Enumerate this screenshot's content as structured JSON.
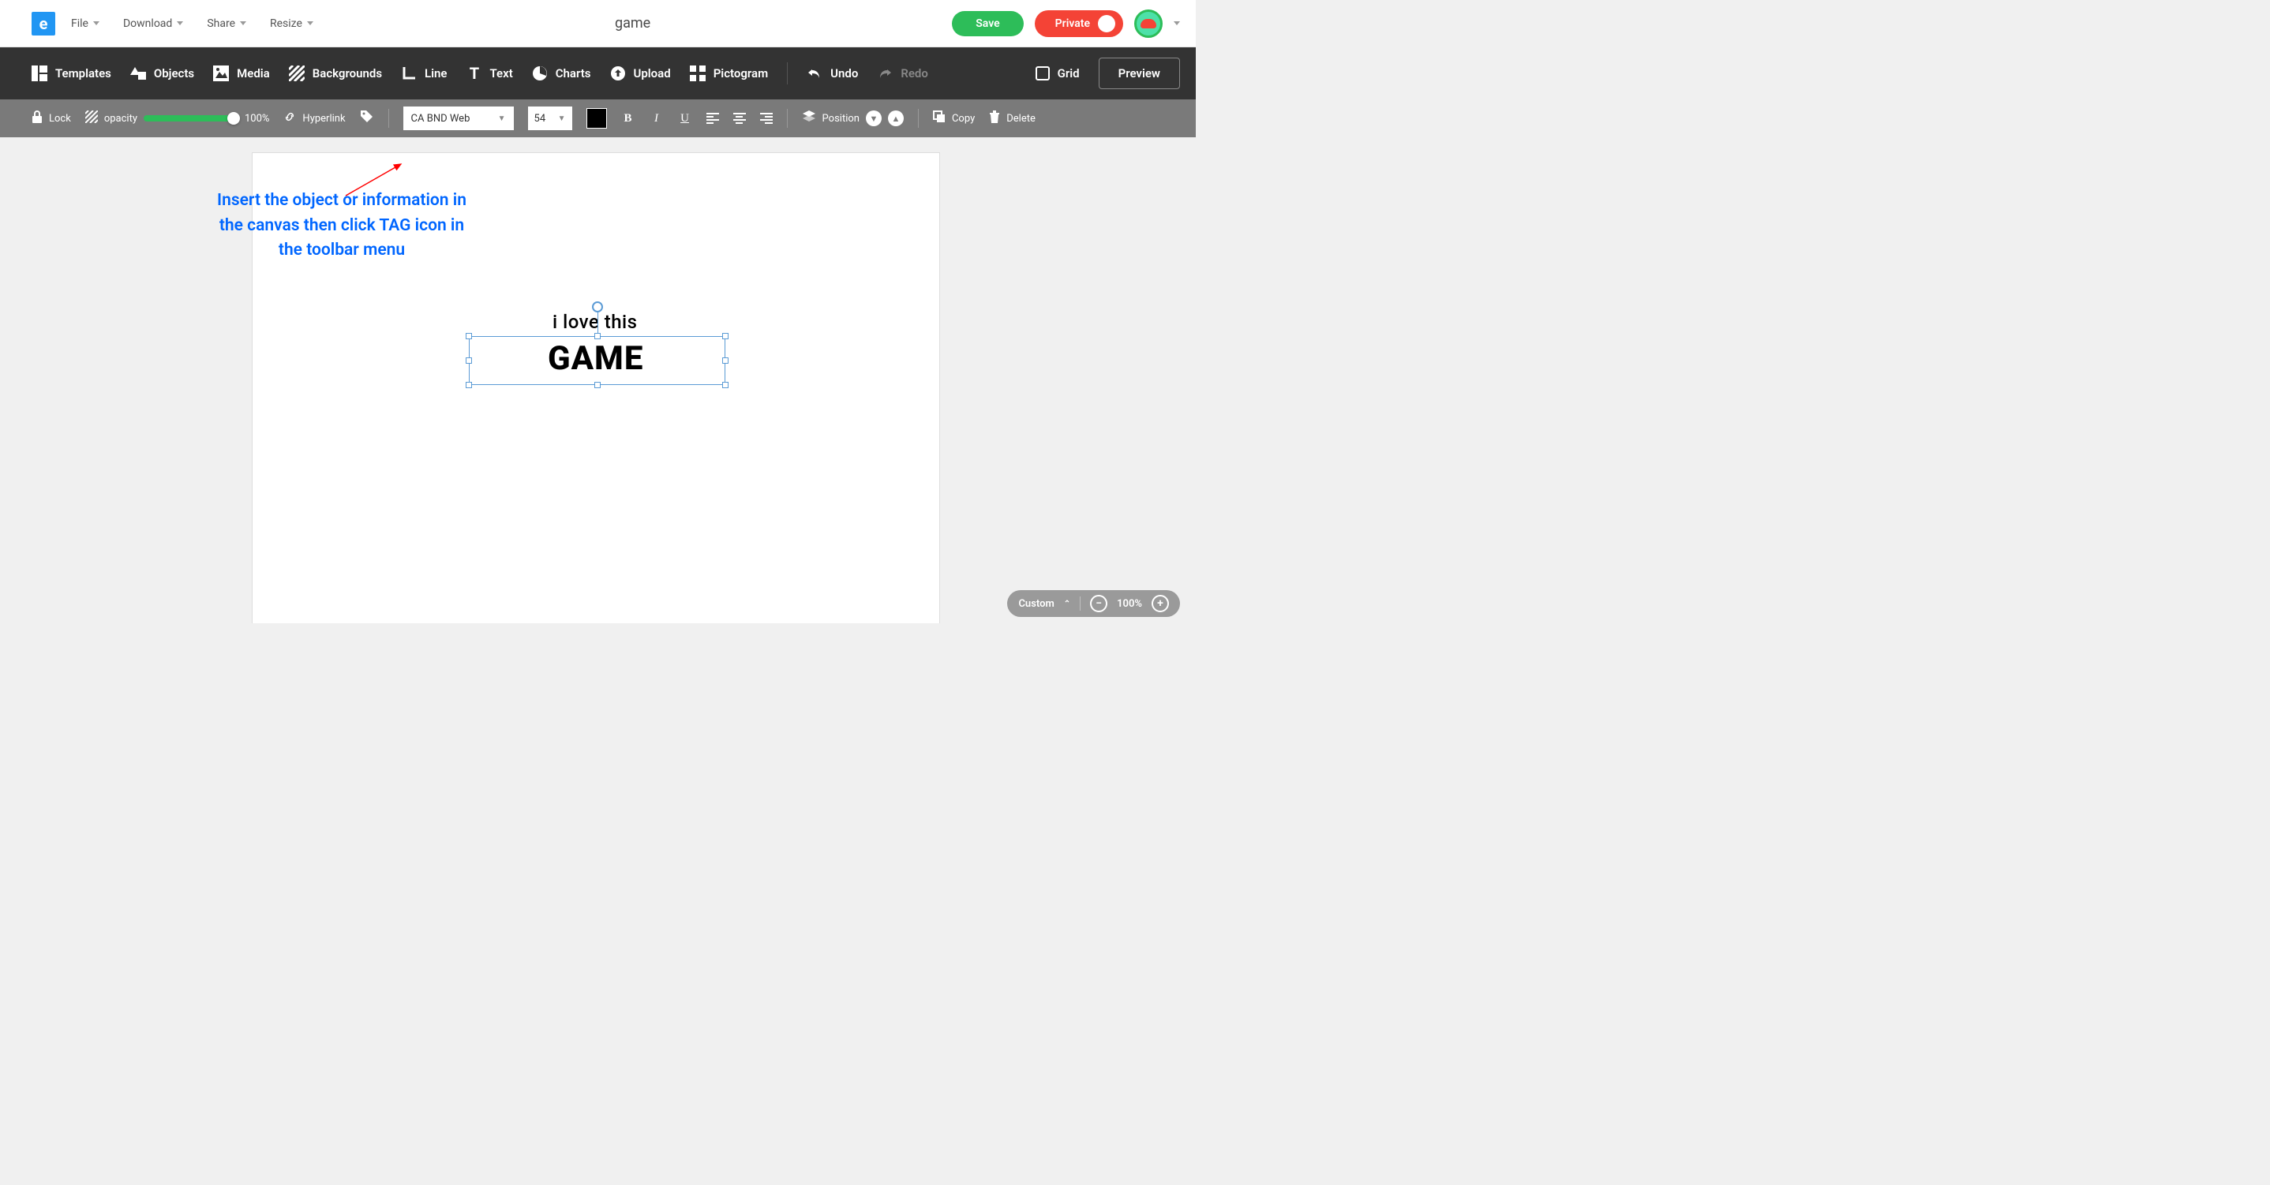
{
  "topbar": {
    "menu": [
      "File",
      "Download",
      "Share",
      "Resize"
    ],
    "title": "game",
    "save_label": "Save",
    "private_label": "Private"
  },
  "toolbar": {
    "items": [
      "Templates",
      "Objects",
      "Media",
      "Backgrounds",
      "Line",
      "Text",
      "Charts",
      "Upload",
      "Pictogram"
    ],
    "undo": "Undo",
    "redo": "Redo",
    "grid": "Grid",
    "preview": "Preview"
  },
  "subtoolbar": {
    "lock": "Lock",
    "opacity_label": "opacity",
    "opacity_value": "100%",
    "hyperlink": "Hyperlink",
    "font": "CA BND Web",
    "font_size": "54",
    "position": "Position",
    "copy": "Copy",
    "delete": "Delete"
  },
  "annotation": {
    "text": "Insert the object or information in the canvas then click TAG icon in the toolbar menu"
  },
  "canvas": {
    "line1": "i love this",
    "line2": "GAME"
  },
  "zoom": {
    "custom": "Custom",
    "level": "100%"
  },
  "colors": {
    "accent_green": "#2dbd59",
    "accent_red": "#f44336",
    "logo_blue": "#2196f3",
    "tool_dark": "#333333",
    "tool_grey": "#7a7a7a",
    "annotation_blue": "#0066ff",
    "selection_blue": "#5b9bd5"
  }
}
